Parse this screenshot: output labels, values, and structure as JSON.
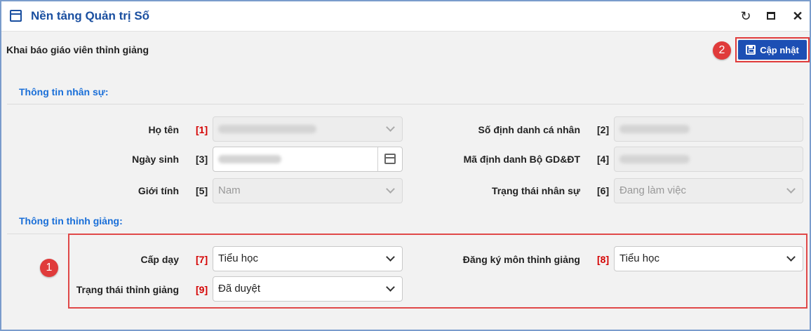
{
  "window": {
    "title": "Nền tảng Quản trị Số",
    "refresh_glyph": "↻",
    "close_glyph": "✕"
  },
  "toolbar": {
    "title": "Khai báo giáo viên thỉnh giảng",
    "update_label": "Cập nhật"
  },
  "callouts": [
    "1",
    "2"
  ],
  "sections": {
    "personnel": "Thông tin nhân sự:",
    "visiting": "Thông tin thỉnh giảng:"
  },
  "personnel_fields": {
    "ho_ten": {
      "label": "Họ tên",
      "num": "[1]"
    },
    "so_dinh_danh": {
      "label": "Số định danh cá nhân",
      "num": "[2]"
    },
    "ngay_sinh": {
      "label": "Ngày sinh",
      "num": "[3]"
    },
    "ma_dinh_danh": {
      "label": "Mã định danh Bộ GD&ĐT",
      "num": "[4]"
    },
    "gioi_tinh": {
      "label": "Giới tính",
      "num": "[5]",
      "value": "Nam"
    },
    "trang_thai_ns": {
      "label": "Trạng thái nhân sự",
      "num": "[6]",
      "value": "Đang làm việc"
    }
  },
  "visiting_fields": {
    "cap_day": {
      "label": "Cấp dạy",
      "num": "[7]",
      "value": "Tiểu học"
    },
    "dang_ky_mon": {
      "label": "Đăng ký môn thỉnh giảng",
      "num": "[8]",
      "value": "Tiểu học"
    },
    "trang_thai_tg": {
      "label": "Trạng thái thỉnh giảng",
      "num": "[9]",
      "value": "Đã duyệt"
    }
  },
  "icons": [
    "window-icon",
    "refresh-icon",
    "maximize-icon",
    "close-icon",
    "save-icon",
    "chevron-down-icon",
    "calendar-icon"
  ]
}
